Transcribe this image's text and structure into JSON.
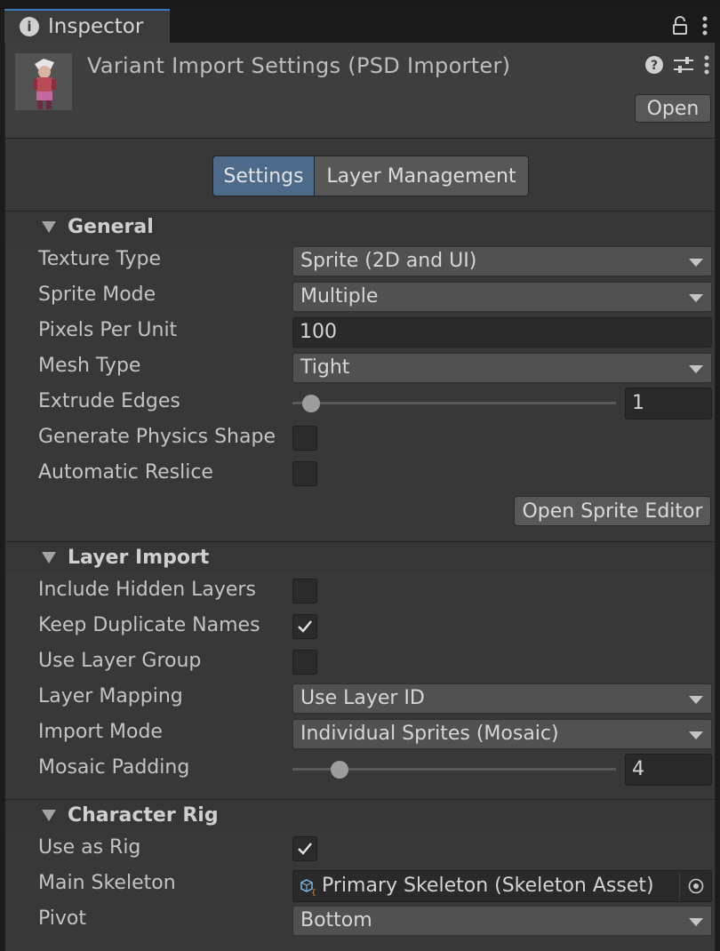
{
  "tab": {
    "title": "Inspector",
    "icon": "info-icon"
  },
  "header": {
    "title": "Variant Import Settings (PSD Importer)",
    "open_label": "Open"
  },
  "segments": {
    "settings": "Settings",
    "layer_management": "Layer Management",
    "selected": "Settings"
  },
  "general": {
    "title": "General",
    "texture_type": {
      "label": "Texture Type",
      "value": "Sprite (2D and UI)"
    },
    "sprite_mode": {
      "label": "Sprite Mode",
      "value": "Multiple"
    },
    "pixels_per_unit": {
      "label": "Pixels Per Unit",
      "value": "100"
    },
    "mesh_type": {
      "label": "Mesh Type",
      "value": "Tight"
    },
    "extrude_edges": {
      "label": "Extrude Edges",
      "value": "1",
      "min": 0,
      "max": 32
    },
    "generate_physics_shape": {
      "label": "Generate Physics Shape",
      "checked": false
    },
    "automatic_reslice": {
      "label": "Automatic Reslice",
      "checked": false
    },
    "open_sprite_editor": "Open Sprite Editor"
  },
  "layer_import": {
    "title": "Layer Import",
    "include_hidden_layers": {
      "label": "Include Hidden Layers",
      "checked": false
    },
    "keep_duplicate_names": {
      "label": "Keep Duplicate Names",
      "checked": true
    },
    "use_layer_group": {
      "label": "Use Layer Group",
      "checked": false
    },
    "layer_mapping": {
      "label": "Layer Mapping",
      "value": "Use Layer ID"
    },
    "import_mode": {
      "label": "Import Mode",
      "value": "Individual Sprites (Mosaic)"
    },
    "mosaic_padding": {
      "label": "Mosaic Padding",
      "value": "4",
      "min": 0,
      "max": 32
    }
  },
  "character_rig": {
    "title": "Character Rig",
    "use_as_rig": {
      "label": "Use as Rig",
      "checked": true
    },
    "main_skeleton": {
      "label": "Main Skeleton",
      "value": "Primary Skeleton (Skeleton Asset)"
    },
    "pivot": {
      "label": "Pivot",
      "value": "Bottom"
    }
  },
  "colors": {
    "selected_tab_accent": "#3a79bb",
    "selected_segment": "#4e6a8a"
  }
}
